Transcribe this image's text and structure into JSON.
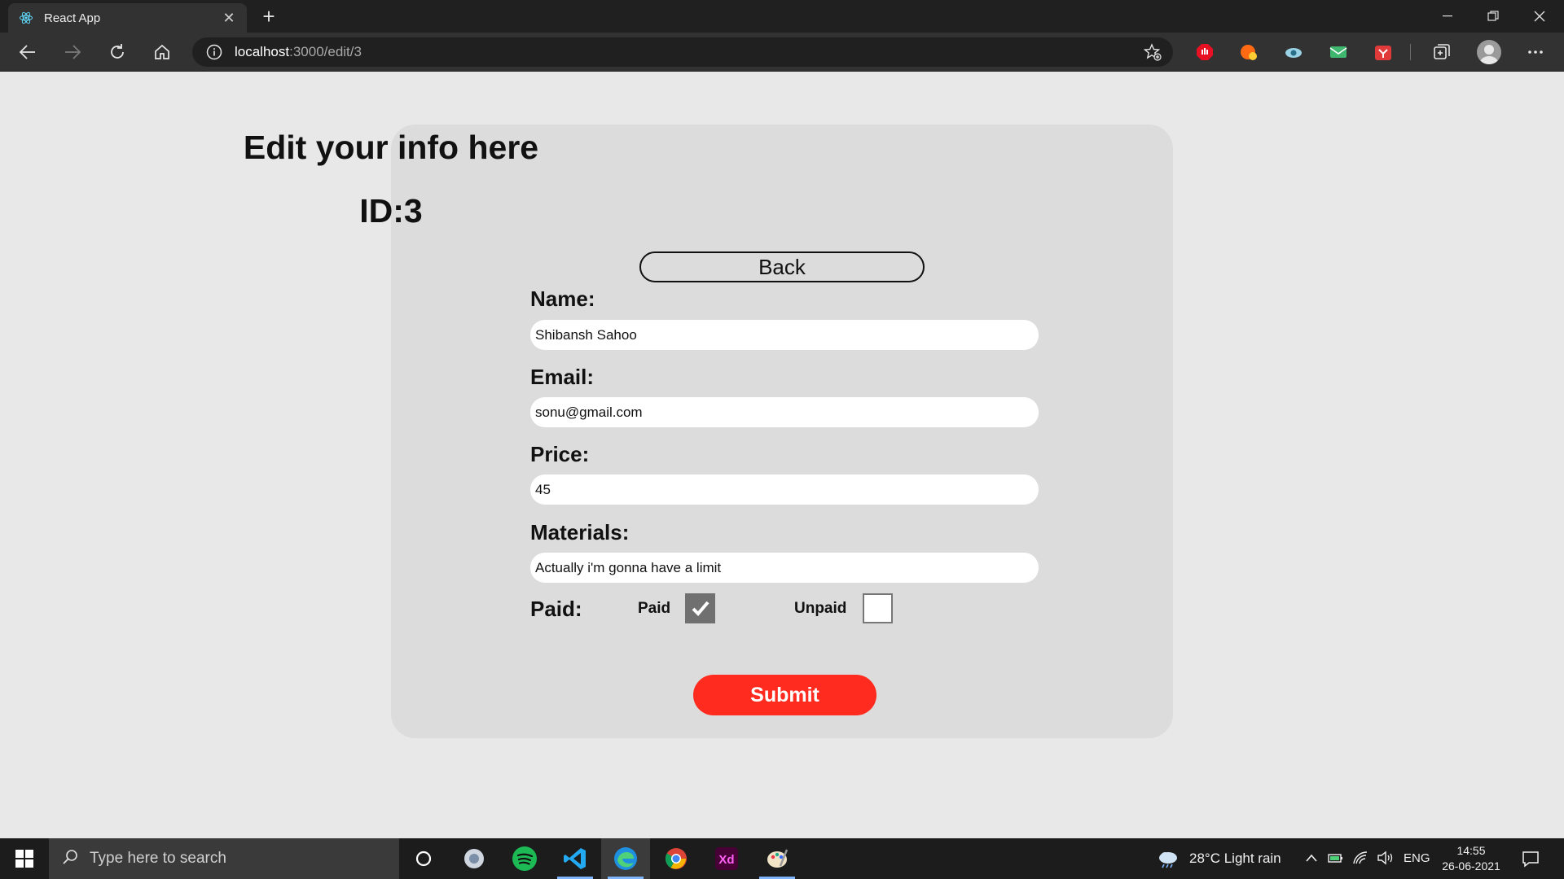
{
  "browser": {
    "tab_title": "React App",
    "url_host": "localhost",
    "url_path": ":3000/edit/3",
    "icons": [
      "react-icon",
      "close-icon",
      "plus-icon",
      "minimize-icon",
      "restore-icon",
      "window-close-icon",
      "back-arrow-icon",
      "forward-arrow-icon",
      "refresh-icon",
      "home-icon",
      "info-icon",
      "favorite-star-icon",
      "profile-icon",
      "more-icon"
    ]
  },
  "page": {
    "title": "Edit your info here",
    "id_label": "ID:3",
    "back_label": "Back",
    "fields": {
      "name_label": "Name:",
      "name_value": "Shibansh Sahoo",
      "email_label": "Email:",
      "email_value": "sonu@gmail.com",
      "price_label": "Price:",
      "price_value": "45",
      "materials_label": "Materials:",
      "materials_value": "Actually i'm gonna have a limit"
    },
    "paid": {
      "label": "Paid:",
      "paid_option": "Paid",
      "unpaid_option": "Unpaid",
      "paid_checked": true,
      "unpaid_checked": false
    },
    "submit_label": "Submit",
    "colors": {
      "submit": "#ff2b1f",
      "card": "#dcdcdc",
      "background": "#e8e8e8"
    }
  },
  "taskbar": {
    "search_placeholder": "Type here to search",
    "weather": "28°C  Light rain",
    "language": "ENG",
    "time": "14:55",
    "date": "26-06-2021"
  }
}
